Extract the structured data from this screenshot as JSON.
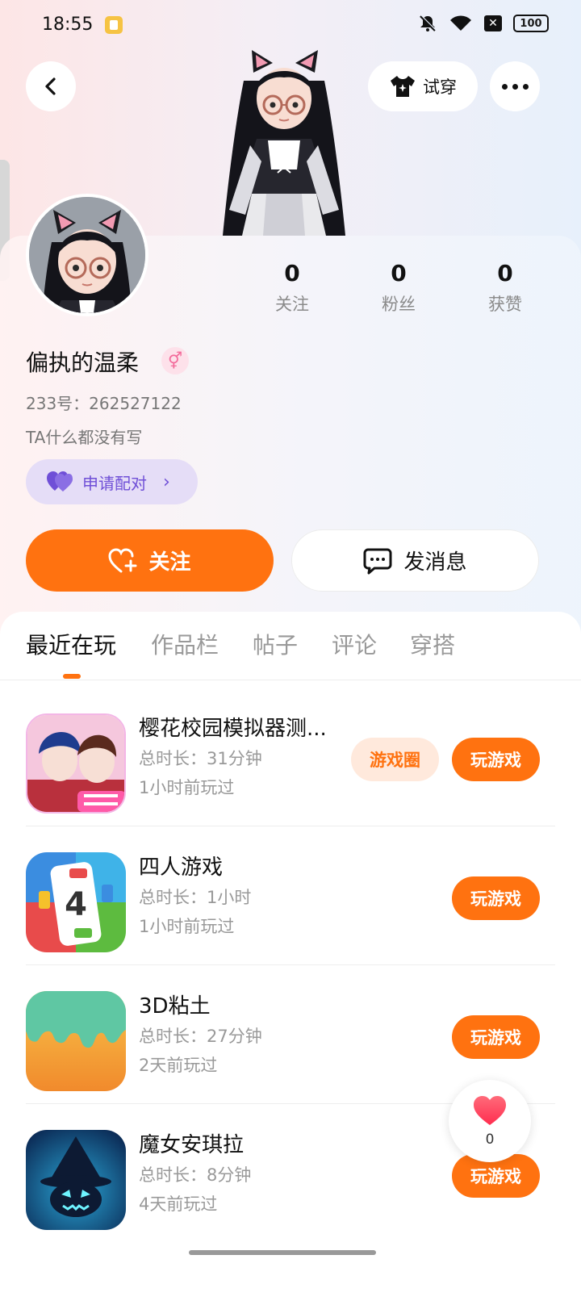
{
  "status_bar": {
    "time": "18:55",
    "battery": "100"
  },
  "header": {
    "tryon_label": "试穿"
  },
  "profile": {
    "username": "偏执的温柔",
    "gender_symbol": "⚥",
    "uid_text": "233号：262527122",
    "bio": "TA什么都没有写",
    "match_label": "申请配对",
    "stats": [
      {
        "value": "0",
        "label": "关注"
      },
      {
        "value": "0",
        "label": "粉丝"
      },
      {
        "value": "0",
        "label": "获赞"
      }
    ]
  },
  "actions": {
    "follow_label": "关注",
    "message_label": "发消息"
  },
  "tabs": [
    "最近在玩",
    "作品栏",
    "帖子",
    "评论",
    "穿搭"
  ],
  "games": [
    {
      "title": "樱花校园模拟器测...",
      "duration": "总时长：31分钟",
      "last_played": "1小时前玩过",
      "circle_label": "游戏圈",
      "play_label": "玩游戏",
      "icon": "sakura-school-icon"
    },
    {
      "title": "四人游戏",
      "duration": "总时长：1小时",
      "last_played": "1小时前玩过",
      "play_label": "玩游戏",
      "icon": "four-player-icon"
    },
    {
      "title": "3D粘土",
      "duration": "总时长：27分钟",
      "last_played": "2天前玩过",
      "play_label": "玩游戏",
      "icon": "clay-icon"
    },
    {
      "title": "魔女安琪拉",
      "duration": "总时长：8分钟",
      "last_played": "4天前玩过",
      "play_label": "玩游戏",
      "icon": "witch-icon"
    }
  ],
  "like_float": {
    "count": "0"
  },
  "colors": {
    "accent": "#ff7210",
    "match_purple": "#6f4fd7"
  }
}
